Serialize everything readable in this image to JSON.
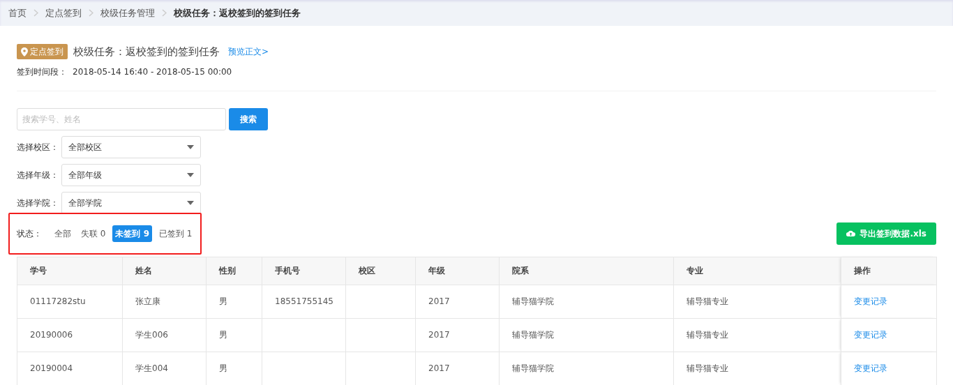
{
  "breadcrumb": [
    {
      "label": "首页",
      "current": false
    },
    {
      "label": "定点签到",
      "current": false
    },
    {
      "label": "校级任务管理",
      "current": false
    },
    {
      "label": "校级任务：返校签到的签到任务",
      "current": true
    }
  ],
  "task": {
    "tag": "定点签到",
    "title": "校级任务：返校签到的签到任务",
    "preview_link": "预览正文>",
    "time_label": "签到时间段：",
    "time_value": "2018-05-14 16:40 - 2018-05-15 00:00"
  },
  "search": {
    "placeholder": "搜索学号、姓名",
    "button": "搜索"
  },
  "filters": [
    {
      "label": "选择校区：",
      "value": "全部校区"
    },
    {
      "label": "选择年级：",
      "value": "全部年级"
    },
    {
      "label": "选择学院：",
      "value": "全部学院"
    }
  ],
  "status": {
    "label": "状态：",
    "options": [
      {
        "label": "全部",
        "selected": false
      },
      {
        "label": "失联 0",
        "selected": false
      },
      {
        "label": "未签到 9",
        "selected": true
      },
      {
        "label": "已签到 1",
        "selected": false
      }
    ]
  },
  "export_button": "导出签到数据.xls",
  "table": {
    "columns": [
      "学号",
      "姓名",
      "性别",
      "手机号",
      "校区",
      "年级",
      "院系",
      "专业",
      "操作"
    ],
    "rows": [
      [
        "01117282stu",
        "张立康",
        "男",
        "18551755145",
        "",
        "2017",
        "辅导猫学院",
        "辅导猫专业",
        "变更记录"
      ],
      [
        "20190006",
        "学生006",
        "男",
        "",
        "",
        "2017",
        "辅导猫学院",
        "辅导猫专业",
        "变更记录"
      ],
      [
        "20190004",
        "学生004",
        "男",
        "",
        "",
        "2017",
        "辅导猫学院",
        "辅导猫专业",
        "变更记录"
      ]
    ]
  }
}
